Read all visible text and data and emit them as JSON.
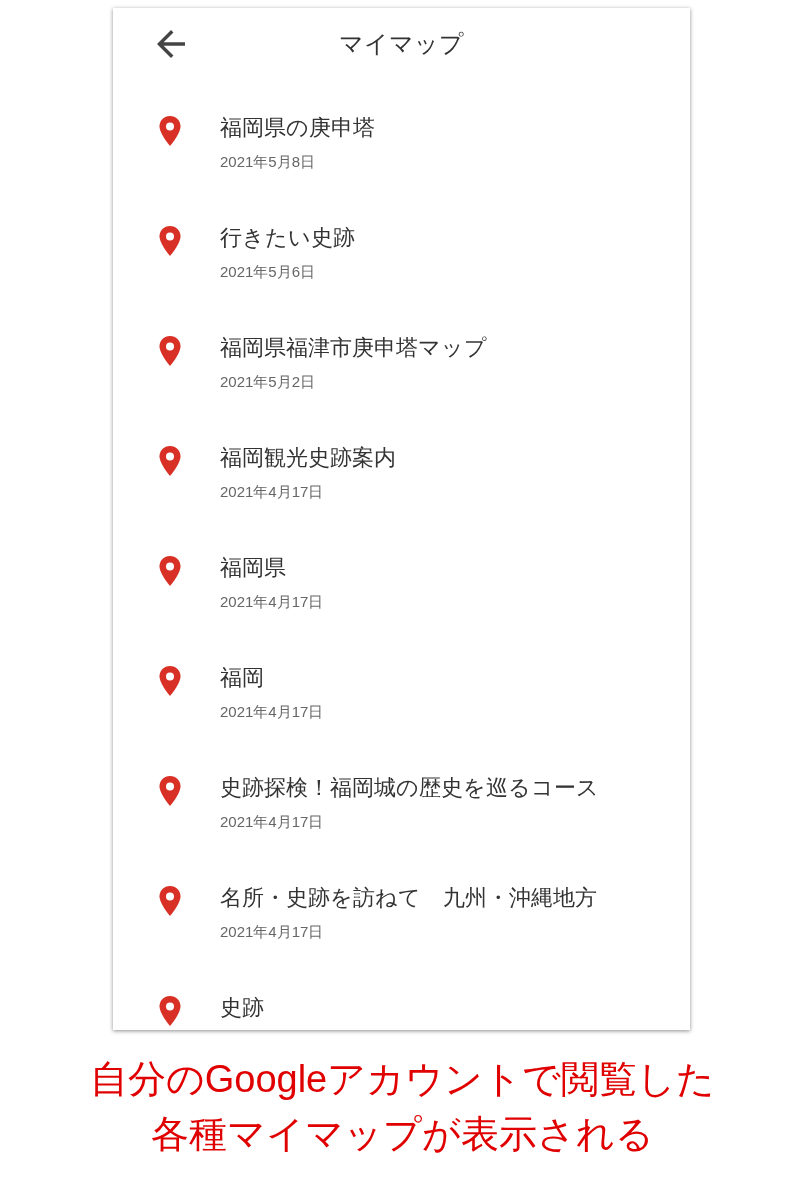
{
  "header": {
    "title": "マイマップ"
  },
  "maps": [
    {
      "title": "福岡県の庚申塔",
      "date": "2021年5月8日"
    },
    {
      "title": "行きたい史跡",
      "date": "2021年5月6日"
    },
    {
      "title": "福岡県福津市庚申塔マップ",
      "date": "2021年5月2日"
    },
    {
      "title": "福岡観光史跡案内",
      "date": "2021年4月17日"
    },
    {
      "title": "福岡県",
      "date": "2021年4月17日"
    },
    {
      "title": "福岡",
      "date": "2021年4月17日"
    },
    {
      "title": "史跡探検！福岡城の歴史を巡るコース",
      "date": "2021年4月17日"
    },
    {
      "title": "名所・史跡を訪ねて　九州・沖縄地方",
      "date": "2021年4月17日"
    },
    {
      "title": "史跡"
    }
  ],
  "caption_lines": [
    "自分のGoogleアカウントで閲覧した",
    "各種マイマップが表示される"
  ]
}
